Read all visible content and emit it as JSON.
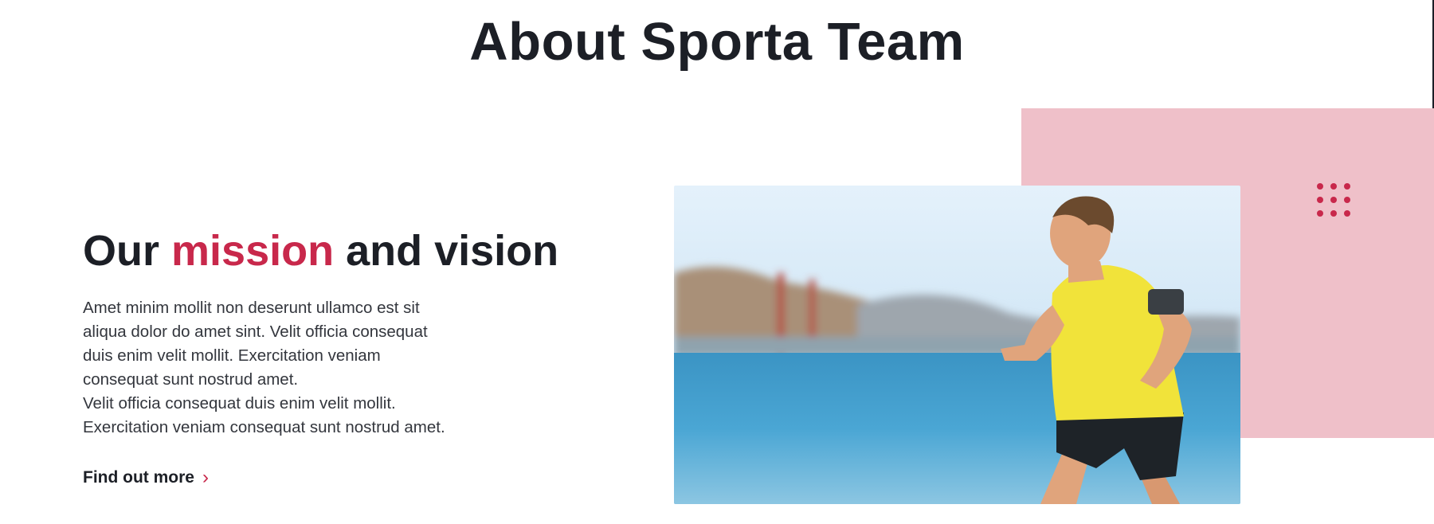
{
  "section": {
    "title": "About Sporta Team"
  },
  "mission": {
    "title_before": "Our ",
    "title_accent": "mission",
    "title_after": " and vision",
    "body": "Amet minim mollit non deserunt ullamco est sit\naliqua dolor do amet sint. Velit officia consequat\nduis enim velit mollit. Exercitation veniam\nconsequat sunt nostrud amet.\nVelit officia consequat duis enim velit mollit.\nExercitation veniam consequat sunt nostrud amet.",
    "cta_label": "Find out more",
    "cta_icon": "chevron-right-icon"
  },
  "colors": {
    "accent": "#c8284b",
    "panel_pink": "#efc0c9",
    "heading": "#1c1f26"
  }
}
